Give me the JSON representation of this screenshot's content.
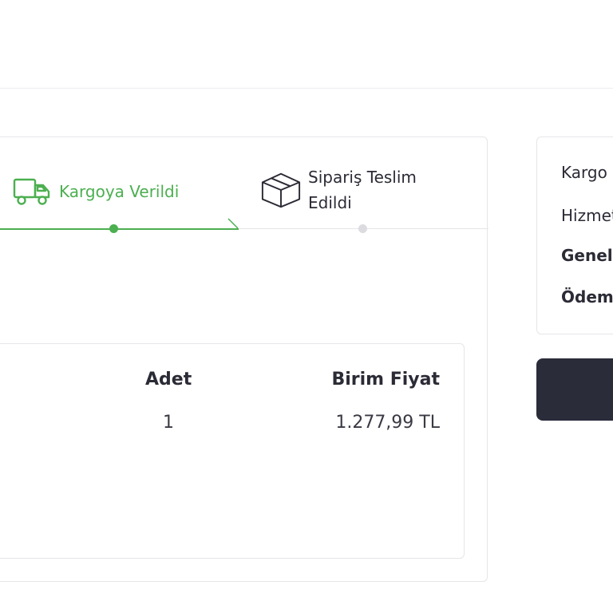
{
  "tracker": {
    "steps": [
      {
        "label": "Kargoya Verildi",
        "icon": "truck-icon",
        "state": "active"
      },
      {
        "label": "Sipariş Teslim Edildi",
        "icon": "box-icon",
        "state": "pending"
      }
    ]
  },
  "table": {
    "headers": {
      "qty": "Adet",
      "unit_price": "Birim Fiyat"
    },
    "rows": [
      {
        "qty": "1",
        "unit_price": "1.277,99 TL"
      }
    ]
  },
  "summary": {
    "rows": [
      "Kargo",
      "Hizmet",
      "Genel",
      "Ödem"
    ]
  },
  "colors": {
    "accent": "#4caf50",
    "dark": "#2b2c3a",
    "border": "#e6e6ea",
    "pending": "#dcdce0"
  }
}
